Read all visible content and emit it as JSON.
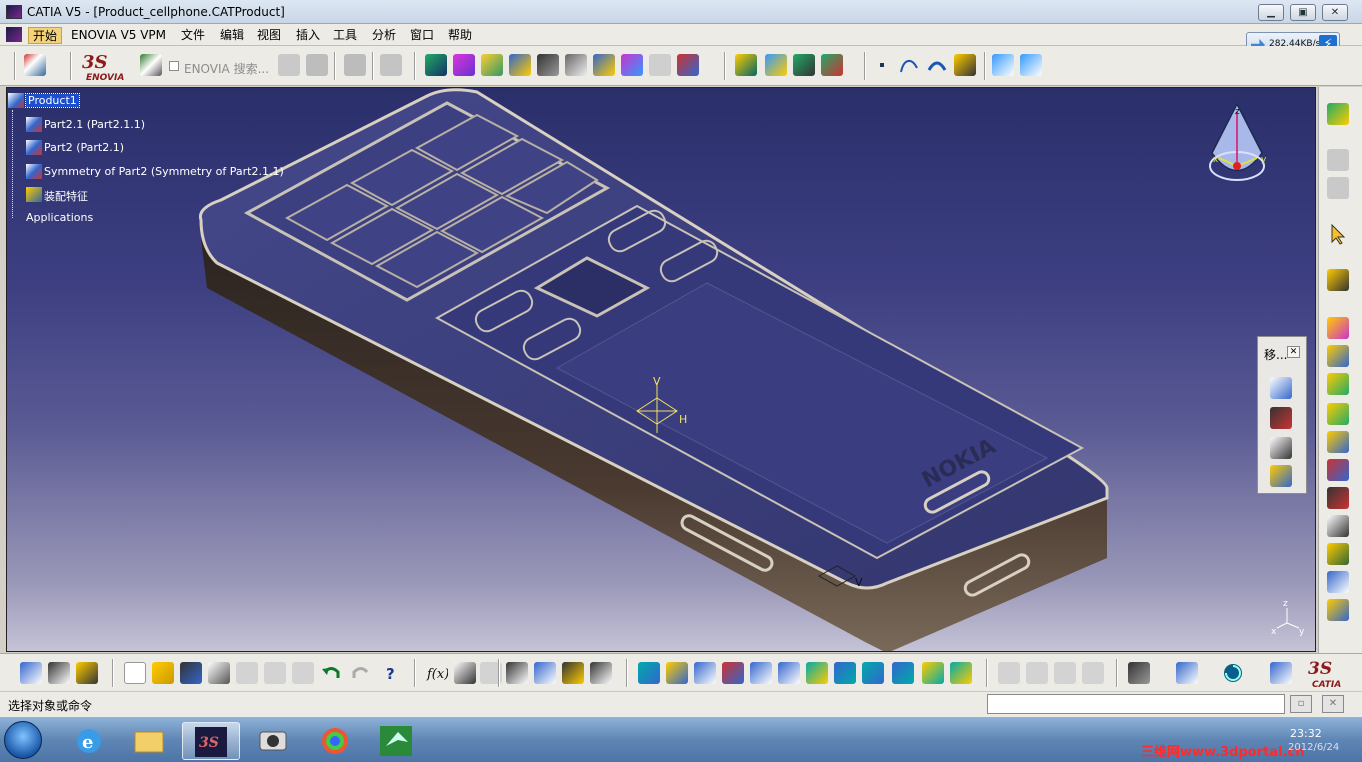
{
  "window": {
    "title": "CATIA V5 - [Product_cellphone.CATProduct]",
    "buttons": [
      "minimize",
      "restore",
      "close"
    ]
  },
  "menu": {
    "items": [
      "开始",
      "ENOVIA V5 VPM",
      "文件",
      "编辑",
      "视图",
      "插入",
      "工具",
      "分析",
      "窗口",
      "帮助"
    ],
    "active": "开始"
  },
  "net_widget": {
    "rate": "282.44KB/s"
  },
  "toolbar_top": {
    "enovia_search_label": "ENOVIA 搜索..."
  },
  "tree": {
    "items": [
      {
        "label": "Product1",
        "selected": true,
        "icon": "product-icon"
      },
      {
        "label": "Part2.1 (Part2.1.1)",
        "icon": "part-icon"
      },
      {
        "label": "Part2 (Part2.1)",
        "icon": "part-icon"
      },
      {
        "label": "Symmetry of Part2 (Symmetry of Part2.1.1)",
        "icon": "part-icon"
      },
      {
        "label": "装配特征",
        "icon": "assembly-feature-icon"
      },
      {
        "label": "Applications",
        "icon": "none"
      }
    ]
  },
  "viewport": {
    "axis_labels": {
      "compass_z": "z",
      "compass_x": "x",
      "compass_y": "y",
      "triad_z": "z",
      "triad_x": "x",
      "triad_y": "y",
      "part_v": "V",
      "part_h": "H",
      "part_v2": "V"
    },
    "phone_brand": "NOKIA",
    "colors": {
      "bg_top": "#2a2f6a",
      "bg_bottom": "#c5c3d6",
      "phone_body": "#3b3d78",
      "phone_edge": "#d8c8a8"
    }
  },
  "float_panel": {
    "title": "移..."
  },
  "statusbar": {
    "message": "选择对象或命令"
  },
  "taskbar": {
    "clock": "23:32",
    "date": "2012/6/24",
    "watermark": "三维网www.3dportal.cn"
  }
}
